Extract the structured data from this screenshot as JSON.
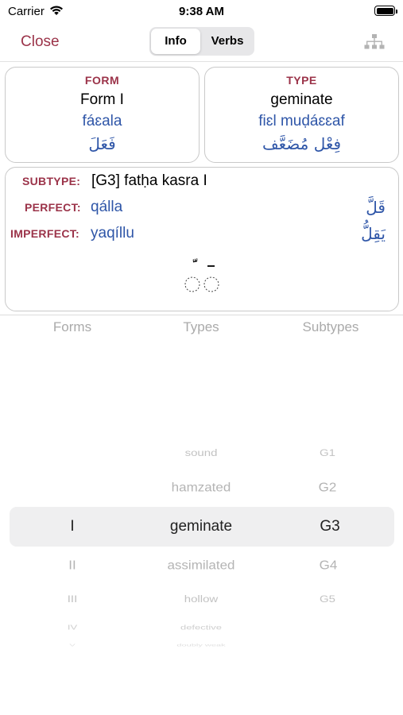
{
  "status_bar": {
    "carrier": "Carrier",
    "time": "9:38 AM"
  },
  "nav": {
    "close_label": "Close",
    "segments": [
      "Info",
      "Verbs"
    ],
    "selected_segment": "Info",
    "right_icon": "hierarchy-icon"
  },
  "form_card": {
    "heading": "FORM",
    "value": "Form I",
    "translit": "fáɛala",
    "arabic": "فَعَلَ"
  },
  "type_card": {
    "heading": "TYPE",
    "value": "geminate",
    "translit": "fiɛl muḍáɛɛaf",
    "arabic": "فِعْل مُضَعَّف"
  },
  "detail_card": {
    "subtype_label": "SUBTYPE:",
    "subtype_value": "[G3] fatḥa kasra I",
    "perfect_label": "PERFECT:",
    "perfect_value": "qálla",
    "perfect_arabic": "قَلَّ",
    "imperfect_label": "IMPERFECT:",
    "imperfect_value": "yaqíllu",
    "imperfect_arabic": "يَقِلُّ"
  },
  "picker": {
    "headers": [
      "Forms",
      "Types",
      "Subtypes"
    ],
    "forms": [
      "I",
      "II",
      "III",
      "IV",
      "V"
    ],
    "types": [
      "sound",
      "hamzated",
      "geminate",
      "assimilated",
      "hollow",
      "defective",
      "doubly weak"
    ],
    "subtypes": [
      "G1",
      "G2",
      "G3",
      "G4",
      "G5"
    ],
    "selected": {
      "form": "I",
      "type": "geminate",
      "subtype": "G3"
    }
  },
  "colors": {
    "accent": "#9b3349",
    "link_blue": "#2f56a8",
    "muted": "#aaaaaa"
  }
}
